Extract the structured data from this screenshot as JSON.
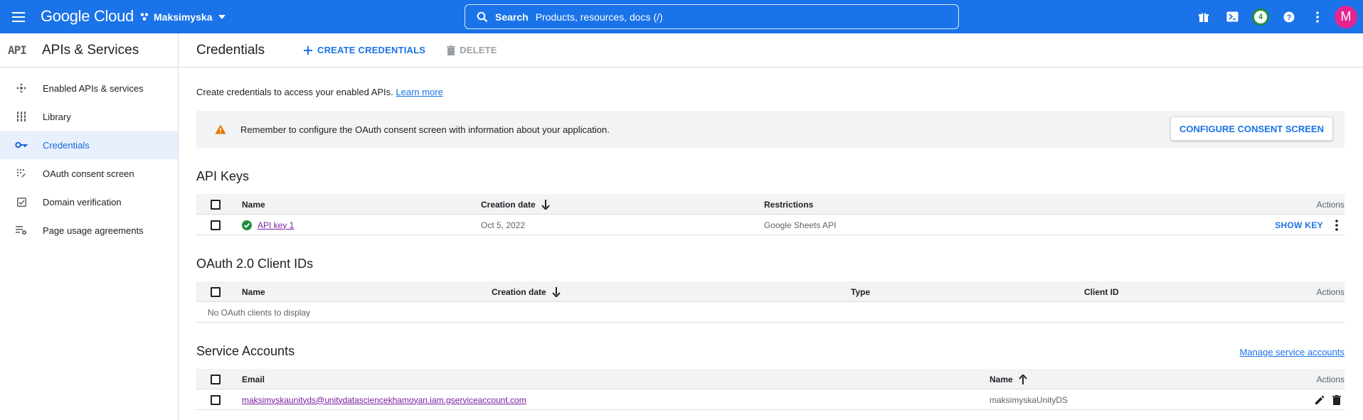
{
  "topbar": {
    "logo": "Google Cloud",
    "project_name": "Maksimyska",
    "search_label": "Search",
    "search_placeholder": "Products, resources, docs (/)",
    "notification_count": "4",
    "avatar_letter": "M",
    "brand_color": "#1a73e8"
  },
  "sidebar": {
    "badge": "API",
    "title": "APIs & Services",
    "items": [
      {
        "label": "Enabled APIs & services",
        "icon": "hub-icon",
        "active": false
      },
      {
        "label": "Library",
        "icon": "library-grid-icon",
        "active": false
      },
      {
        "label": "Credentials",
        "icon": "key-icon",
        "active": true
      },
      {
        "label": "OAuth consent screen",
        "icon": "consent-dots-icon",
        "active": false
      },
      {
        "label": "Domain verification",
        "icon": "check-box-icon",
        "active": false
      },
      {
        "label": "Page usage agreements",
        "icon": "list-settings-icon",
        "active": false
      }
    ]
  },
  "main": {
    "title": "Credentials",
    "create_label": "CREATE CREDENTIALS",
    "delete_label": "DELETE",
    "intro_text": "Create credentials to access your enabled APIs.",
    "learn_more": "Learn more",
    "banner_text": "Remember to configure the OAuth consent screen with information about your application.",
    "banner_button": "CONFIGURE CONSENT SCREEN"
  },
  "api_keys": {
    "title": "API Keys",
    "headers": {
      "name": "Name",
      "creation_date": "Creation date",
      "restrictions": "Restrictions",
      "actions": "Actions"
    },
    "rows": [
      {
        "name": "API key 1",
        "creation_date": "Oct 5, 2022",
        "restrictions": "Google Sheets API",
        "action": "SHOW KEY"
      }
    ]
  },
  "oauth": {
    "title": "OAuth 2.0 Client IDs",
    "headers": {
      "name": "Name",
      "creation_date": "Creation date",
      "type": "Type",
      "client_id": "Client ID",
      "actions": "Actions"
    },
    "empty_text": "No OAuth clients to display"
  },
  "service_accounts": {
    "title": "Service Accounts",
    "manage_link": "Manage service accounts",
    "headers": {
      "email": "Email",
      "name": "Name",
      "actions": "Actions"
    },
    "rows": [
      {
        "email": "maksimyskaunityds@unitydatasciencekhamoyan.iam.gserviceaccount.com",
        "name": "maksimyskaUnityDS"
      }
    ]
  }
}
